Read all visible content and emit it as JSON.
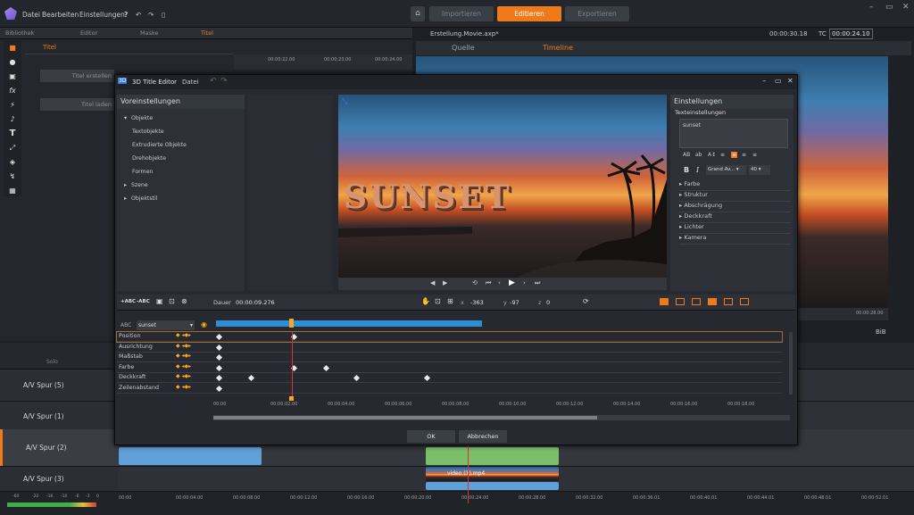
{
  "menubar": {
    "menus": [
      "Datei",
      "Bearbeiten",
      "Einstellungen"
    ],
    "nav": {
      "import": "Importieren",
      "edit": "Editieren",
      "export": "Exportieren"
    },
    "window_controls": [
      "–",
      "▭",
      "✕"
    ],
    "accent": "#f07a1a"
  },
  "left_panel": {
    "tabs": [
      "Bibliothek",
      "Editor",
      "Maske",
      "Titel"
    ],
    "active_tab": "Titel",
    "sub_tab": "Titel",
    "buttons": [
      "Titel erstellen",
      "Titel laden"
    ],
    "ruler": [
      "00:00:22.00",
      "00:00:23.00",
      "00:00:24.00"
    ]
  },
  "preview_panel": {
    "project": "Erstellung.Movie.axp*",
    "duration": "00:00:30.18",
    "tc_label": "TC",
    "timecode": "00:00:24.10",
    "tabs": [
      "Quelle",
      "Timeline"
    ],
    "ruler_end": "00:00:28.00",
    "zoom": "BiB"
  },
  "dialog": {
    "title": "3D Title Editor",
    "menu": "Datei",
    "presets_header": "Voreinstellungen",
    "tree": [
      {
        "label": "Objekte",
        "expanded": true
      },
      {
        "label": "Textobjekte"
      },
      {
        "label": "Extrudierte Objekte"
      },
      {
        "label": "Drehobjekte"
      },
      {
        "label": "Formen"
      },
      {
        "label": "Szene",
        "expanded": false
      },
      {
        "label": "Objektstil",
        "expanded": false
      }
    ],
    "canvas_text": "SUNSET",
    "settings_header": "Einstellungen",
    "text_settings_label": "Texteinstellungen",
    "text_value": "sunset",
    "font_name": "Grand Av...",
    "font_size": "40",
    "settings_items": [
      "Farbe",
      "Struktur",
      "Abschrägung",
      "Deckkraft",
      "Lichter",
      "Kamera"
    ],
    "timeline": {
      "toolbar_abc1": "+ABC",
      "toolbar_abc2": "-ABC",
      "duration_label": "Dauer",
      "duration": "00:00:09.276",
      "x_label": "x",
      "x": "-363",
      "y_label": "y",
      "y": "-97",
      "z_label": "z",
      "z": "0",
      "object_label": "ABC",
      "object_select": "sunset",
      "properties": [
        "Position",
        "Ausrichtung",
        "Maßstab",
        "Farbe",
        "Deckkraft",
        "Zeilenabstand"
      ],
      "ruler": [
        "00:00",
        "00:00:02.00",
        "00:00:04.00",
        "00:00:06.00",
        "00:00:08.00",
        "00:00:10.00",
        "00:00:12.00",
        "00:00:14.00",
        "00:00:16.00",
        "00:00:18.00"
      ]
    },
    "ok": "OK",
    "cancel": "Abbrechen"
  },
  "tracks": {
    "header_label": "Solo",
    "names": [
      "A/V Spur (5)",
      "A/V Spur (1)",
      "A/V Spur (2)",
      "A/V Spur (3)"
    ],
    "clip_label": "video (1).mp4",
    "meter_scale": [
      "-60",
      "-22",
      "-16",
      "-10",
      "-6",
      "-3",
      "0"
    ],
    "ruler": [
      "00:00",
      "00:00:04.00",
      "00:00:08.00",
      "00:00:12.00",
      "00:00:16.00",
      "00:00:20.00",
      "00:00:24.00",
      "00:00:28.00",
      "00:00:32.00",
      "00:00:36.01",
      "00:00:40.01",
      "00:00:44.01",
      "00:00:48.01",
      "00:00:52.01"
    ]
  }
}
